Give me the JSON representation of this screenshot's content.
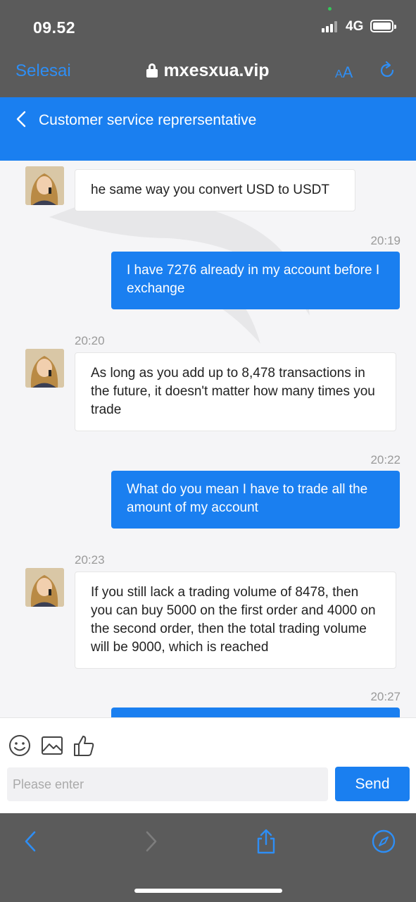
{
  "status_bar": {
    "time": "09.52",
    "network": "4G"
  },
  "browser": {
    "done_label": "Selesai",
    "url": "mxesxua.vip",
    "text_size_label_small": "A",
    "text_size_label_large": "A"
  },
  "header": {
    "title": "Customer service reprersentative"
  },
  "messages": [
    {
      "from": "agent",
      "timestamp": "",
      "text": "he same way you convert USD to USDT"
    },
    {
      "from": "user",
      "timestamp": "20:19",
      "text": "I have 7276 already in my account before I exchange"
    },
    {
      "from": "agent",
      "timestamp": "20:20",
      "text": "As long as you add up to 8,478 transactions in the future, it doesn't matter how many times you trade"
    },
    {
      "from": "user",
      "timestamp": "20:22",
      "text": "What do you mean I have to trade all the amount of my account"
    },
    {
      "from": "agent",
      "timestamp": "20:23",
      "text": "If you still lack a trading volume of 8478, then you can buy 5000 on the first order and 4000 on the second order, then the total trading volume will be 9000, which is reached"
    },
    {
      "from": "user",
      "timestamp": "20:27",
      "text": ""
    }
  ],
  "composer": {
    "placeholder": "Please enter",
    "send_label": "Send",
    "tools": [
      "emoji-icon",
      "image-icon",
      "thumbs-up-icon"
    ]
  },
  "colors": {
    "brand_blue": "#1a7ff0",
    "browser_chrome": "#5b5b5b",
    "link_blue": "#2e8ef5"
  }
}
